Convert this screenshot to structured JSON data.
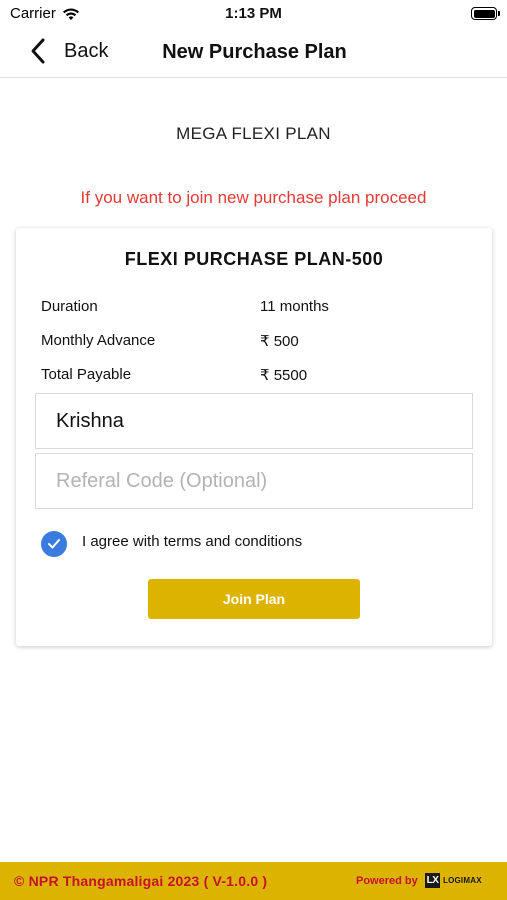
{
  "status_bar": {
    "carrier": "Carrier",
    "time": "1:13 PM",
    "icons": [
      "wifi-icon",
      "battery-icon"
    ]
  },
  "nav": {
    "back_label": "Back",
    "title": "New Purchase Plan",
    "icons": [
      "chevron-left-icon"
    ]
  },
  "plan": {
    "heading": "MEGA FLEXI PLAN",
    "note": "If you want to join new purchase plan proceed",
    "note_color": "#e53935"
  },
  "card": {
    "title": "FLEXI PURCHASE PLAN-500",
    "rows": [
      {
        "label": "Duration",
        "value": "11 months"
      },
      {
        "label": "Monthly Advance",
        "value": "₹ 500"
      },
      {
        "label": "Total Payable",
        "value": "₹ 5500"
      }
    ],
    "name_field": {
      "value": "Krishna",
      "placeholder": ""
    },
    "referral_field": {
      "value": "",
      "placeholder": "Referal Code (Optional)"
    },
    "terms": {
      "label": "I agree with terms and conditions",
      "checked": true
    },
    "join_button": "Join Plan"
  },
  "footer": {
    "copyright": "© NPR Thangamaligai 2023 ( V-1.0.0 )",
    "powered_by": "Powered by",
    "brand_logo": {
      "mark": "LX",
      "word": "LOGIMAX"
    },
    "accent_color": "#dcb400",
    "text_color": "#c8102e"
  }
}
